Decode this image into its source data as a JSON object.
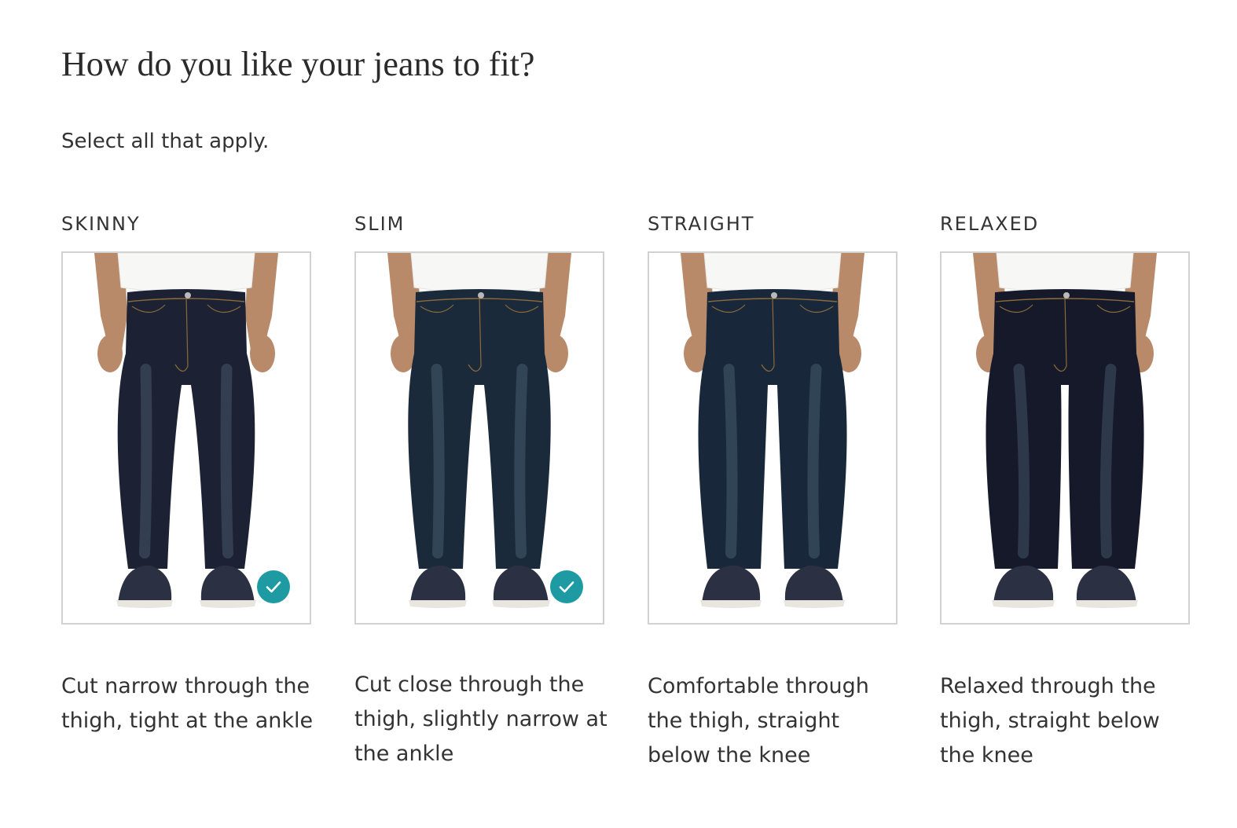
{
  "page": {
    "title": "How do you like your jeans to fit?",
    "subtitle": "Select all that apply."
  },
  "options": [
    {
      "label": "SKINNY",
      "description": "Cut narrow through the thigh, tight at the ankle",
      "selected": true,
      "fit": "skinny",
      "denim_color": "#1c2233"
    },
    {
      "label": "SLIM",
      "description": "Cut close through the thigh, slightly narrow at the ankle",
      "selected": true,
      "fit": "slim",
      "denim_color": "#1b2a3a"
    },
    {
      "label": "STRAIGHT",
      "description": "Comfortable through the thigh, straight below the knee",
      "selected": false,
      "fit": "straight",
      "denim_color": "#18283a"
    },
    {
      "label": "RELAXED",
      "description": "Relaxed through the thigh, straight below the knee",
      "selected": false,
      "fit": "relaxed",
      "denim_color": "#15192a"
    }
  ],
  "colors": {
    "accent": "#1e9aa3",
    "card_border": "#d2d2d2",
    "text": "#333333",
    "skin": "#b98a69",
    "shirt": "#f7f7f5",
    "shoe": "#2b3042",
    "sole": "#e9e6df"
  },
  "icons": {
    "check": "checkmark-icon"
  }
}
